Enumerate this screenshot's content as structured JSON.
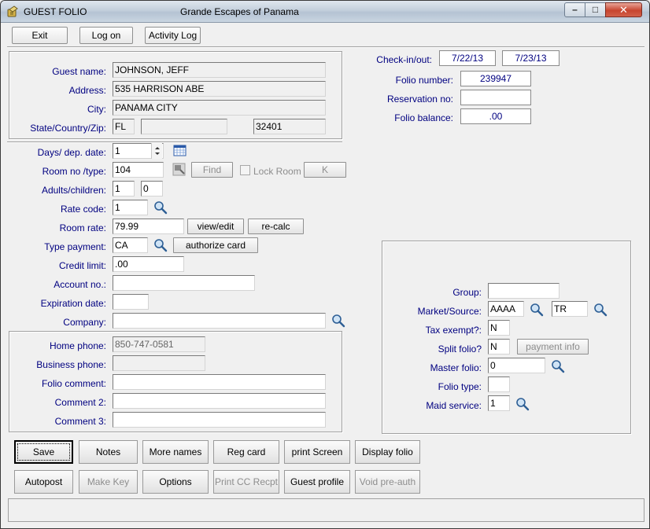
{
  "window": {
    "title": "GUEST FOLIO",
    "org": "Grande Escapes of Panama",
    "controls": {
      "minimize": "–",
      "maximize": "□",
      "close": "✕"
    }
  },
  "toolbar": {
    "exit": "Exit",
    "logon": "Log on",
    "activity_log": "Activity Log"
  },
  "guest": {
    "name_label": "Guest name:",
    "name": "JOHNSON, JEFF",
    "address_label": "Address:",
    "address": "535 HARRISON ABE",
    "city_label": "City:",
    "city": "PANAMA CITY",
    "scz_label": "State/Country/Zip:",
    "state": "FL",
    "country": "",
    "zip": "32401"
  },
  "folio_info": {
    "checkinout_label": "Check-in/out:",
    "checkin": "7/22/13",
    "checkout": "7/23/13",
    "folio_number_label": "Folio number:",
    "folio_number": "239947",
    "reservation_label": "Reservation no:",
    "reservation": "",
    "balance_label": "Folio balance:",
    "balance": ".00"
  },
  "stay": {
    "days_label": "Days/ dep. date:",
    "days": "1",
    "room_label": "Room no /type:",
    "room_no": "104",
    "room_type": "",
    "find": "Find",
    "lock_room": "Lock Room",
    "k_button": "K",
    "adults_label": "Adults/children:",
    "adults": "1",
    "children": "0",
    "rate_code_label": "Rate code:",
    "rate_code": "1",
    "room_rate_label": "Room rate:",
    "room_rate": "79.99",
    "view_edit": "view/edit",
    "recalc": "re-calc",
    "type_payment_label": "Type payment:",
    "type_payment": "CA",
    "authorize_card": "authorize card",
    "credit_limit_label": "Credit limit:",
    "credit_limit": ".00",
    "account_label": "Account no.:",
    "account": "",
    "expiration_label": "Expiration date:",
    "expiration": "",
    "company_label": "Company:",
    "company": ""
  },
  "contact": {
    "home_phone_label": "Home phone:",
    "home_phone": "850-747-0581",
    "business_phone_label": "Business phone:",
    "business_phone": "",
    "folio_comment_label": "Folio comment:",
    "folio_comment": "",
    "comment2_label": "Comment 2:",
    "comment2": "",
    "comment3_label": "Comment 3:",
    "comment3": ""
  },
  "extra": {
    "group_label": "Group:",
    "group": "",
    "market_label": "Market/Source:",
    "market": "AAAA",
    "source": "TR",
    "tax_exempt_label": "Tax exempt?:",
    "tax_exempt": "N",
    "split_folio_label": "Split folio?",
    "split_folio": "N",
    "payment_info": "payment info",
    "master_folio_label": "Master folio:",
    "master_folio": "0",
    "folio_type_label": "Folio type:",
    "folio_type": "",
    "maid_service_label": "Maid service:",
    "maid_service": "1"
  },
  "actions": {
    "save": "Save",
    "notes": "Notes",
    "more_names": "More names",
    "reg_card": "Reg card",
    "print_screen": "print Screen",
    "display_folio": "Display folio",
    "autopost": "Autopost",
    "make_key": "Make Key",
    "options": "Options",
    "print_cc": "Print CC Recpt",
    "guest_profile": "Guest profile",
    "void_preauth": "Void pre-auth"
  },
  "status": {
    "text": ""
  }
}
